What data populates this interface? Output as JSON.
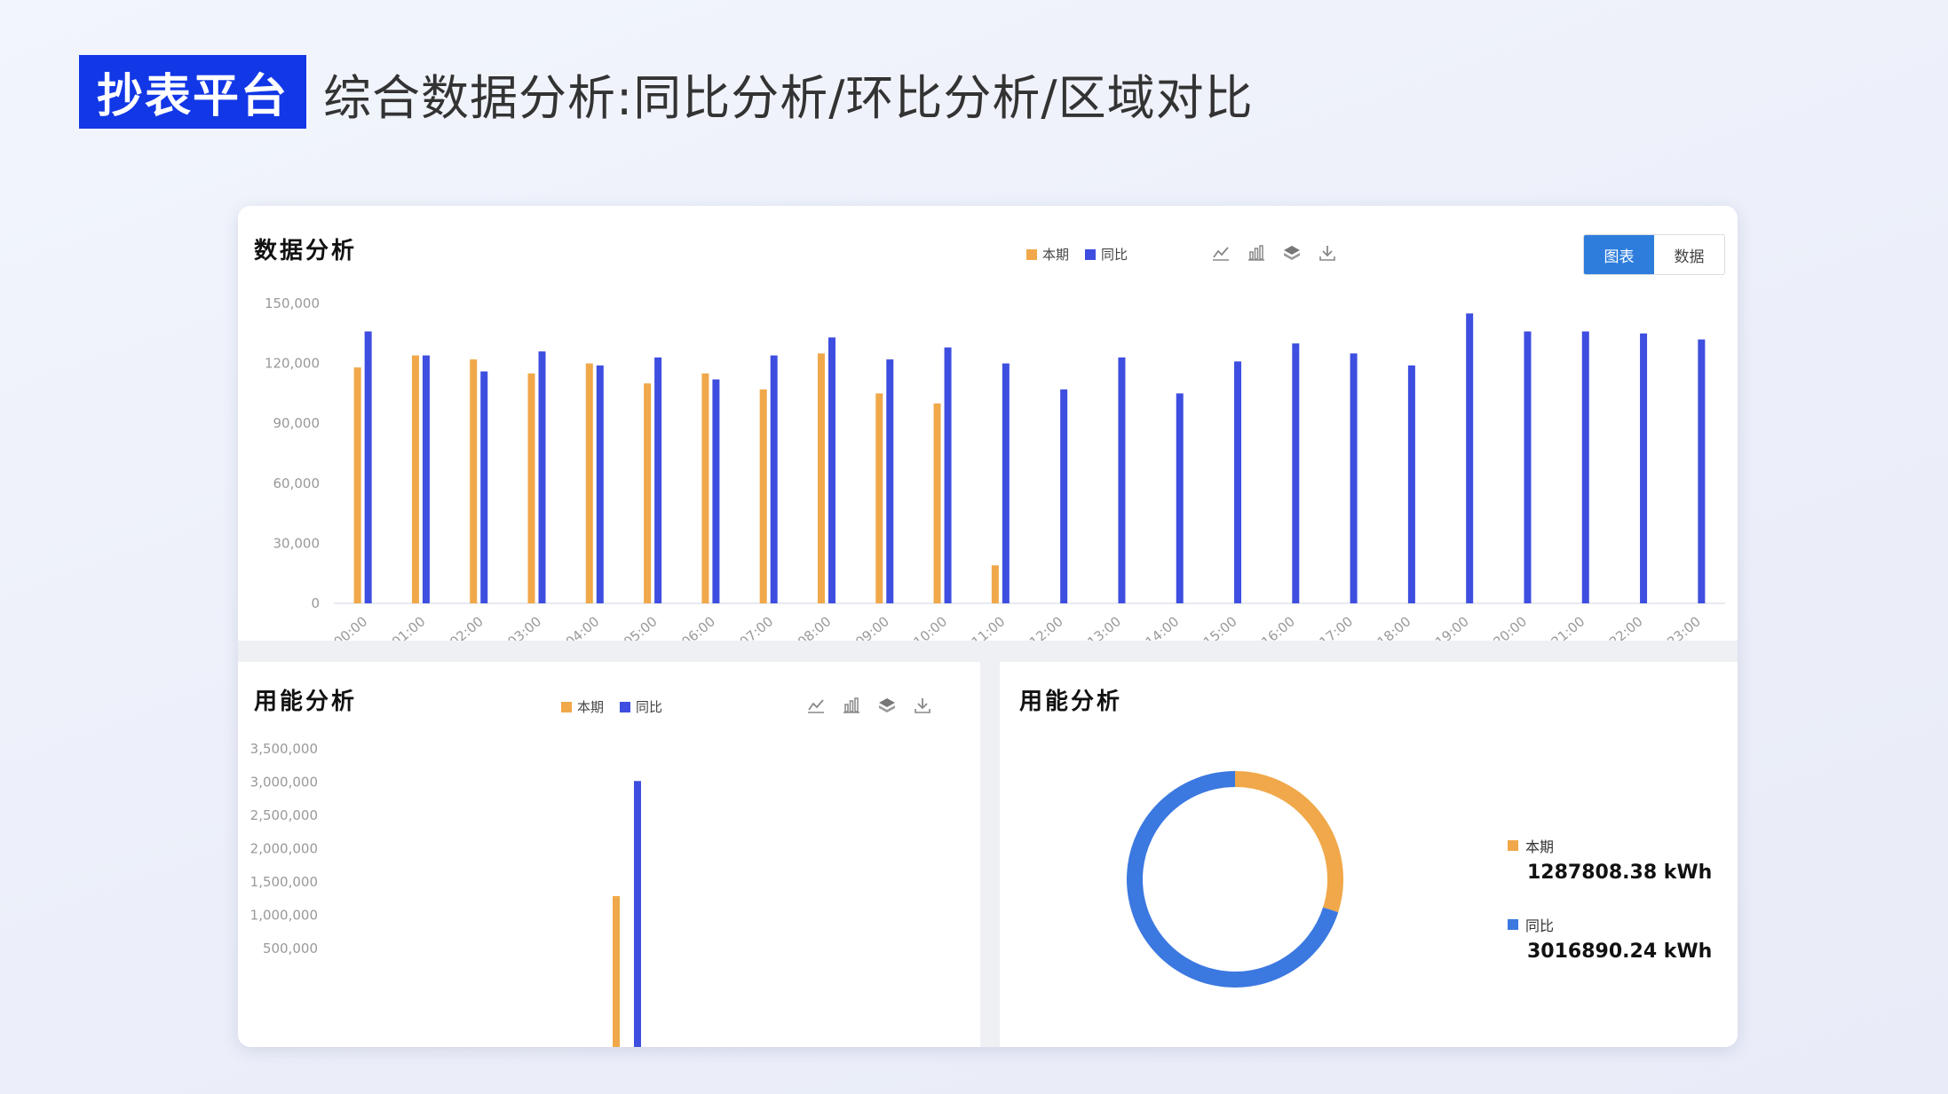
{
  "header": {
    "brand": "抄表平台",
    "headline": "综合数据分析:同比分析/环比分析/区域对比"
  },
  "colors": {
    "brand_blue": "#1237e6",
    "current": "#f0a84a",
    "yoy": "#3e4ee0",
    "donut_yoy": "#3b78e0",
    "toggle_active": "#2e7ddc"
  },
  "top_panel": {
    "title": "数据分析",
    "legend": {
      "current": "本期",
      "yoy": "同比"
    },
    "toolbox": [
      "line-chart-icon",
      "bar-chart-icon",
      "stack-icon",
      "download-icon"
    ],
    "view_toggle": {
      "chart": "图表",
      "data": "数据",
      "active": "chart"
    }
  },
  "bottom_left": {
    "title": "用能分析",
    "legend": {
      "current": "本期",
      "yoy": "同比"
    },
    "toolbox": [
      "line-chart-icon",
      "bar-chart-icon",
      "stack-icon",
      "download-icon"
    ]
  },
  "bottom_right": {
    "title": "用能分析",
    "entries": [
      {
        "name": "本期",
        "value": "1287808.38 kWh"
      },
      {
        "name": "同比",
        "value": "3016890.24 kWh"
      }
    ]
  },
  "chart_data": [
    {
      "type": "bar",
      "title": "数据分析",
      "categories": [
        "00:00",
        "01:00",
        "02:00",
        "03:00",
        "04:00",
        "05:00",
        "06:00",
        "07:00",
        "08:00",
        "09:00",
        "10:00",
        "11:00",
        "12:00",
        "13:00",
        "14:00",
        "15:00",
        "16:00",
        "17:00",
        "18:00",
        "19:00",
        "20:00",
        "21:00",
        "22:00",
        "23:00"
      ],
      "y_ticks": [
        "0",
        "30,000",
        "60,000",
        "90,000",
        "120,000",
        "150,000"
      ],
      "ylim": [
        0,
        150000
      ],
      "series": [
        {
          "name": "本期",
          "values": [
            118000,
            124000,
            122000,
            115000,
            120000,
            110000,
            115000,
            107000,
            125000,
            105000,
            100000,
            19000,
            null,
            null,
            null,
            null,
            null,
            null,
            null,
            null,
            null,
            null,
            null,
            null
          ]
        },
        {
          "name": "同比",
          "values": [
            136000,
            124000,
            116000,
            126000,
            119000,
            123000,
            112000,
            124000,
            133000,
            122000,
            128000,
            120000,
            107000,
            123000,
            105000,
            121000,
            130000,
            125000,
            119000,
            145000,
            136000,
            136000,
            135000,
            132000
          ]
        }
      ]
    },
    {
      "type": "bar",
      "title": "用能分析",
      "y_ticks": [
        "500,000",
        "1,000,000",
        "1,500,000",
        "2,000,000",
        "2,500,000",
        "3,000,000",
        "3,500,000"
      ],
      "ylim": [
        0,
        3500000
      ],
      "series": [
        {
          "name": "本期",
          "values": [
            1287808.38
          ]
        },
        {
          "name": "同比",
          "values": [
            3016890.24
          ]
        }
      ]
    },
    {
      "type": "pie",
      "title": "用能分析",
      "categories": [
        "本期",
        "同比"
      ],
      "values": [
        1287808.38,
        3016890.24
      ],
      "units": "kWh"
    }
  ]
}
